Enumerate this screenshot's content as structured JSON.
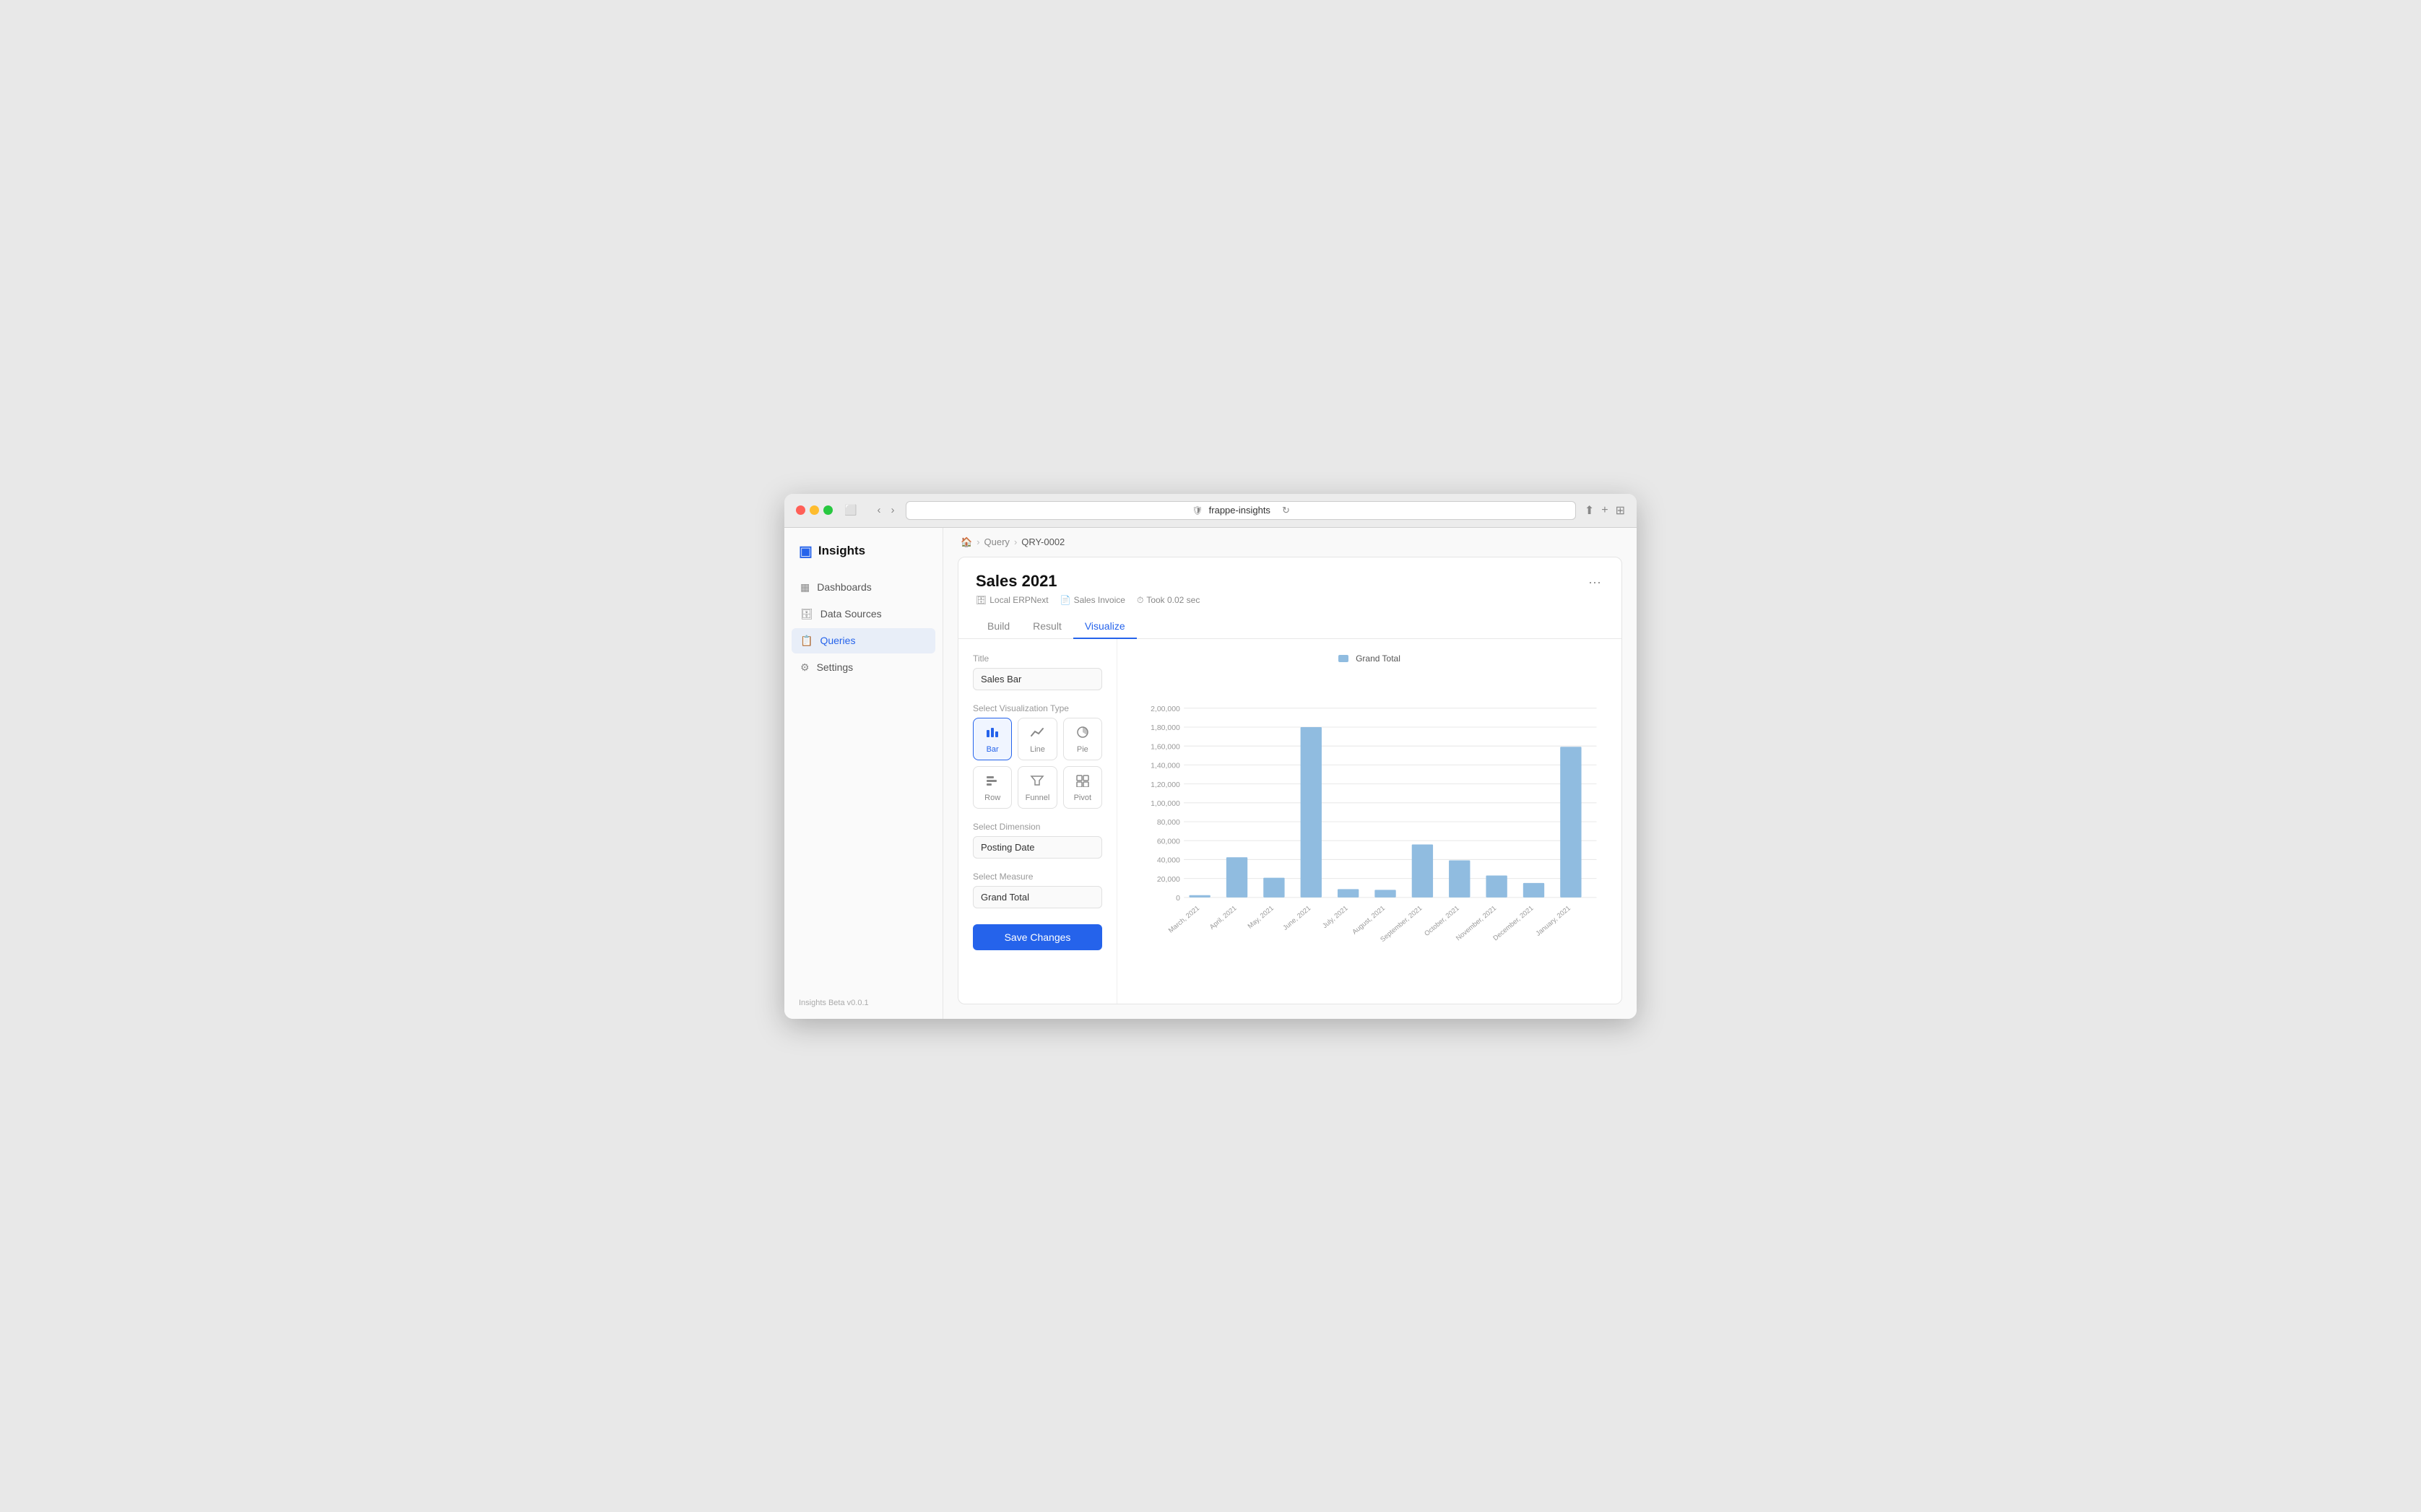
{
  "browser": {
    "url": "frappe-insights",
    "tab_icon": "🛡"
  },
  "sidebar": {
    "logo_icon": "F",
    "logo_text": "Insights",
    "items": [
      {
        "id": "dashboards",
        "label": "Dashboards",
        "icon": "📊",
        "active": false
      },
      {
        "id": "data-sources",
        "label": "Data Sources",
        "icon": "🗄",
        "active": false
      },
      {
        "id": "queries",
        "label": "Queries",
        "icon": "📋",
        "active": true
      },
      {
        "id": "settings",
        "label": "Settings",
        "icon": "⚙",
        "active": false
      }
    ],
    "footer": "Insights Beta v0.0.1"
  },
  "breadcrumb": {
    "home": "🏠",
    "items": [
      "Query",
      "QRY-0002"
    ]
  },
  "query": {
    "title": "Sales 2021",
    "meta": [
      {
        "icon": "🗄",
        "text": "Local ERPNext"
      },
      {
        "icon": "📄",
        "text": "Sales Invoice"
      },
      {
        "icon": "⏱",
        "text": "Took 0.02 sec"
      }
    ]
  },
  "tabs": [
    "Build",
    "Result",
    "Visualize"
  ],
  "active_tab": "Visualize",
  "visualize": {
    "title_label": "Title",
    "title_value": "Sales Bar",
    "title_placeholder": "Sales Bar",
    "viz_type_label": "Select Visualization Type",
    "viz_types": [
      {
        "id": "bar",
        "label": "Bar",
        "icon": "bar",
        "active": true
      },
      {
        "id": "line",
        "label": "Line",
        "icon": "line",
        "active": false
      },
      {
        "id": "pie",
        "label": "Pie",
        "icon": "pie",
        "active": false
      },
      {
        "id": "row",
        "label": "Row",
        "icon": "row",
        "active": false
      },
      {
        "id": "funnel",
        "label": "Funnel",
        "icon": "funnel",
        "active": false
      },
      {
        "id": "pivot",
        "label": "Pivot",
        "icon": "pivot",
        "active": false
      }
    ],
    "dimension_label": "Select Dimension",
    "dimension_value": "Posting Date",
    "measure_label": "Select Measure",
    "measure_value": "Grand Total",
    "save_btn": "Save Changes"
  },
  "chart": {
    "legend_label": "Grand Total",
    "legend_color": "#90bce0",
    "y_axis": [
      "2,00,000",
      "1,80,000",
      "1,60,000",
      "1,40,000",
      "1,20,000",
      "1,00,000",
      "80,000",
      "60,000",
      "40,000",
      "20,000",
      "0"
    ],
    "bars": [
      {
        "label": "March, 2021",
        "value": 2000,
        "max": 200000
      },
      {
        "label": "April, 2021",
        "value": 42000,
        "max": 200000
      },
      {
        "label": "May, 2021",
        "value": 21000,
        "max": 200000
      },
      {
        "label": "June, 2021",
        "value": 180000,
        "max": 200000
      },
      {
        "label": "July, 2021",
        "value": 9000,
        "max": 200000
      },
      {
        "label": "August, 2021",
        "value": 8000,
        "max": 200000
      },
      {
        "label": "September, 2021",
        "value": 56000,
        "max": 200000
      },
      {
        "label": "October, 2021",
        "value": 39000,
        "max": 200000
      },
      {
        "label": "November, 2021",
        "value": 23000,
        "max": 200000
      },
      {
        "label": "December, 2021",
        "value": 15000,
        "max": 200000
      },
      {
        "label": "January, 2021",
        "value": 159000,
        "max": 200000
      }
    ]
  }
}
